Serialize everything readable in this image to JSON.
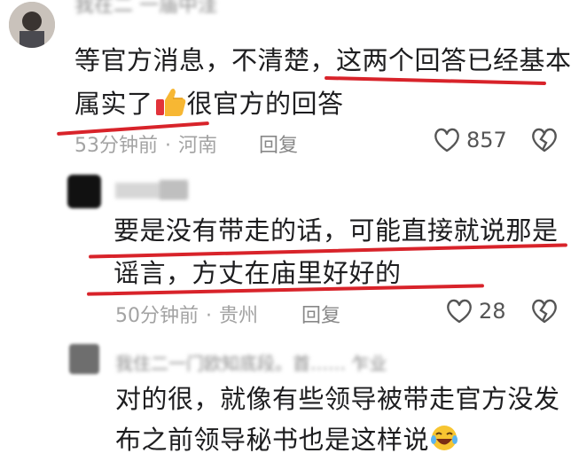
{
  "comments": [
    {
      "username": "我在二    一庙中洼",
      "text_line1": "等官方消息，不清楚，这两个回答已经基本",
      "text_line2_a": "属实了",
      "text_line2_b": "很官方的回答",
      "time": "53分钟前",
      "location": "河南",
      "reply_label": "回复",
      "likes": "857"
    },
    {
      "username": "",
      "text_line1": "要是没有带走的话，可能直接就说那是",
      "text_line2": "谣言，方丈在庙里好好的",
      "time": "50分钟前",
      "location": "贵州",
      "reply_label": "回复",
      "likes": "28"
    },
    {
      "username": "我住二一门欧知底段。首……    乍业",
      "text_line1": "对的很，就像有些领导被带走官方没发",
      "text_line2": "布之前领导秘书也是这样说"
    }
  ],
  "colors": {
    "underline": "#d8232a",
    "meta": "#a3a3a3",
    "text": "#1d1d1f"
  }
}
